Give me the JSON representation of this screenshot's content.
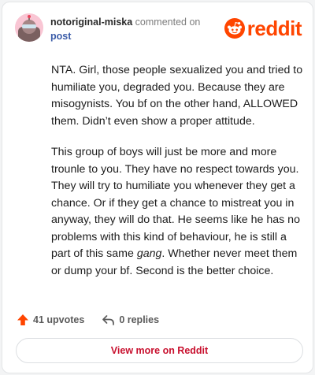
{
  "comment": {
    "username": "notoriginal-miska",
    "action_text": "commented on",
    "post_link_text": "post",
    "paragraphs": [
      "NTA. Girl, those people sexualized you and tried to humiliate you, degraded you. Because they are misogynists. You bf on the other hand, ALLOWED them. Didn’t even show a proper attitude."
    ],
    "paragraph2": {
      "before": "This group of boys will just be more and more trounle to you. They have no respect towards you. They will try to humiliate you whenever they get a chance. Or if they get a chance to mistreat you in anyway, they will do that. He seems like he has no problems with this kind of behaviour, he is still a part of this same ",
      "emphasis": "gang",
      "after": ". Whether never meet them or dump your bf. Second is the better choice."
    }
  },
  "brand": {
    "name": "reddit",
    "color": "#ff4500",
    "icon": "reddit-snoo-icon"
  },
  "footer": {
    "upvotes_label": "41 upvotes",
    "replies_label": "0 replies",
    "upvote_icon": "upvote-arrow-icon",
    "reply_icon": "reply-arrow-icon",
    "upvote_color": "#ff4500"
  },
  "view_more_label": "View more on Reddit",
  "avatar": {
    "icon": "user-avatar-icon",
    "background": "#f9c6d4"
  }
}
